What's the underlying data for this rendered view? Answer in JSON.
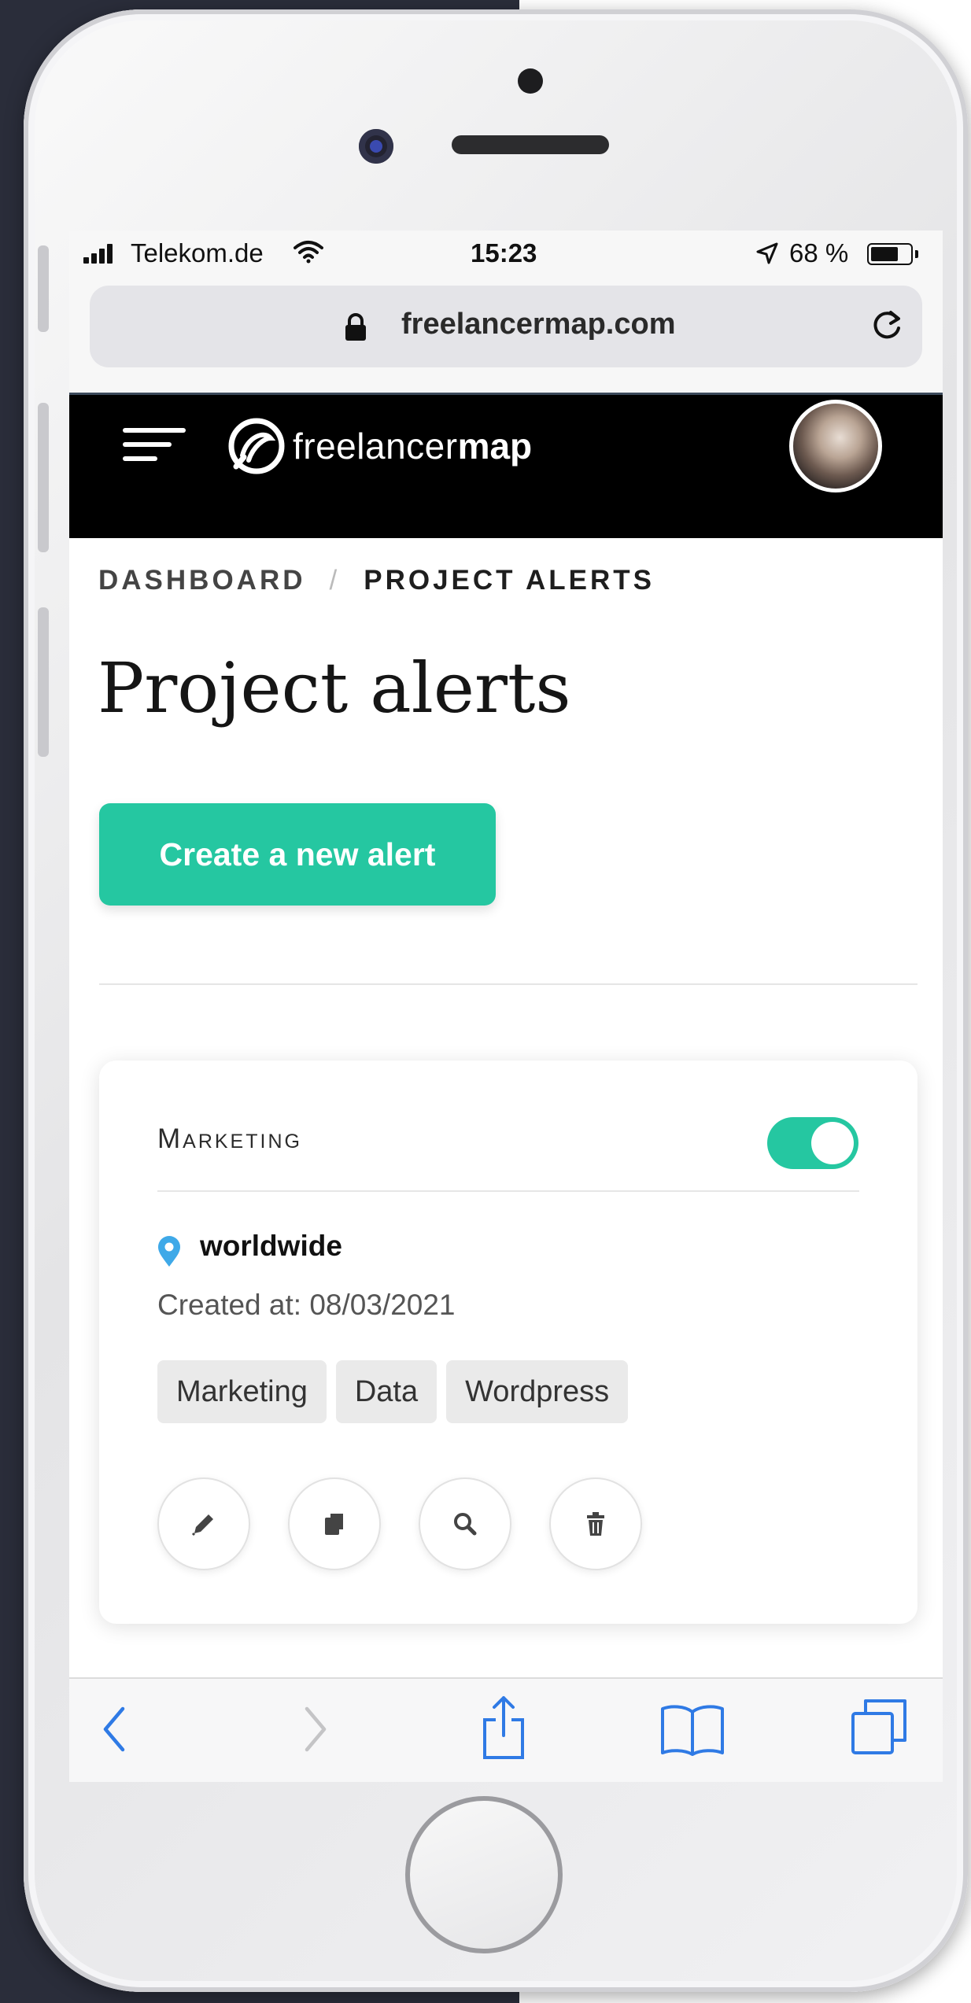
{
  "status_bar": {
    "carrier": "Telekom.de",
    "time": "15:23",
    "battery_percent": "68 %",
    "battery_level": 0.68
  },
  "browser": {
    "url": "freelancermap.com"
  },
  "site_header": {
    "logo_part1": "freelancer",
    "logo_part2": "map"
  },
  "breadcrumb": {
    "home": "DASHBOARD",
    "separator": "/",
    "current": "PROJECT ALERTS"
  },
  "page": {
    "title": "Project alerts",
    "create_button": "Create a new alert"
  },
  "alert_card": {
    "title": "Marketing",
    "enabled": true,
    "location": "worldwide",
    "created": "Created at: 08/03/2021",
    "tags": [
      "Marketing",
      "Data",
      "Wordpress"
    ],
    "actions": [
      "pencil-icon",
      "copy-icon",
      "search-icon",
      "trash-icon"
    ]
  },
  "colors": {
    "accent": "#25c7a1",
    "header_bg": "#000000",
    "ios_blue": "#2f7ae5"
  }
}
